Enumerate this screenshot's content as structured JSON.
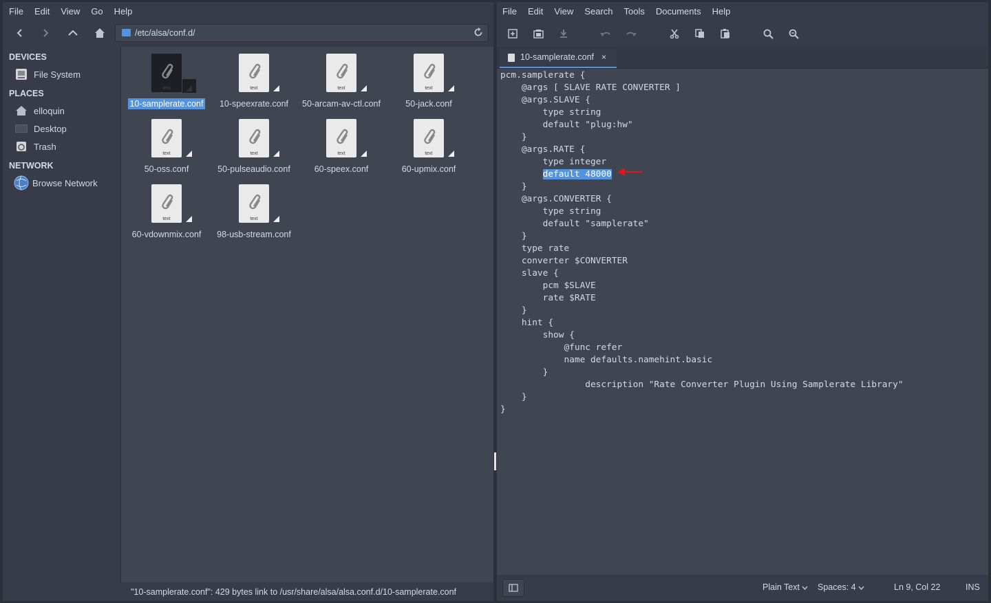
{
  "file_manager": {
    "menu": [
      "File",
      "Edit",
      "View",
      "Go",
      "Help"
    ],
    "path": "/etc/alsa/conf.d/",
    "sidebar": {
      "devices_header": "DEVICES",
      "devices": [
        {
          "label": "File System",
          "icon": "drive-icon"
        }
      ],
      "places_header": "PLACES",
      "places": [
        {
          "label": "elloquin",
          "icon": "home-icon"
        },
        {
          "label": "Desktop",
          "icon": "desktop-icon"
        },
        {
          "label": "Trash",
          "icon": "trash-icon"
        }
      ],
      "network_header": "NETWORK",
      "network": [
        {
          "label": "Browse Network",
          "icon": "network-icon"
        }
      ]
    },
    "files": [
      {
        "name": "10-samplerate.conf",
        "type_label": "text",
        "selected": true
      },
      {
        "name": "10-speexrate.conf",
        "type_label": "text"
      },
      {
        "name": "50-arcam-av-ctl.conf",
        "type_label": "text"
      },
      {
        "name": "50-jack.conf",
        "type_label": "text"
      },
      {
        "name": "50-oss.conf",
        "type_label": "text"
      },
      {
        "name": "50-pulseaudio.conf",
        "type_label": "text"
      },
      {
        "name": "60-speex.conf",
        "type_label": "text"
      },
      {
        "name": "60-upmix.conf",
        "type_label": "text"
      },
      {
        "name": "60-vdownmix.conf",
        "type_label": "text"
      },
      {
        "name": "98-usb-stream.conf",
        "type_label": "text"
      }
    ],
    "status": "\"10-samplerate.conf\": 429 bytes link to /usr/share/alsa/alsa.conf.d/10-samplerate.conf"
  },
  "editor": {
    "menu": [
      "File",
      "Edit",
      "View",
      "Search",
      "Tools",
      "Documents",
      "Help"
    ],
    "tab_title": "10-samplerate.conf",
    "tab_close": "×",
    "code": {
      "before": "pcm.samplerate {\n    @args [ SLAVE RATE CONVERTER ]\n    @args.SLAVE {\n        type string\n        default \"plug:hw\"\n    }\n    @args.RATE {\n        type integer\n        ",
      "selected": "default 48000",
      "after": "\n    }\n    @args.CONVERTER {\n        type string\n        default \"samplerate\"\n    }\n    type rate\n    converter $CONVERTER\n    slave {\n        pcm $SLAVE\n        rate $RATE\n    }\n    hint {\n        show {\n            @func refer\n            name defaults.namehint.basic\n        }\n                description \"Rate Converter Plugin Using Samplerate Library\"\n    }\n}"
    },
    "status": {
      "language": "Plain Text",
      "spaces": "Spaces: 4",
      "position": "Ln 9, Col 22",
      "mode": "INS"
    }
  },
  "colors": {
    "accent": "#5294e2",
    "annotation_arrow": "#e8141c"
  }
}
